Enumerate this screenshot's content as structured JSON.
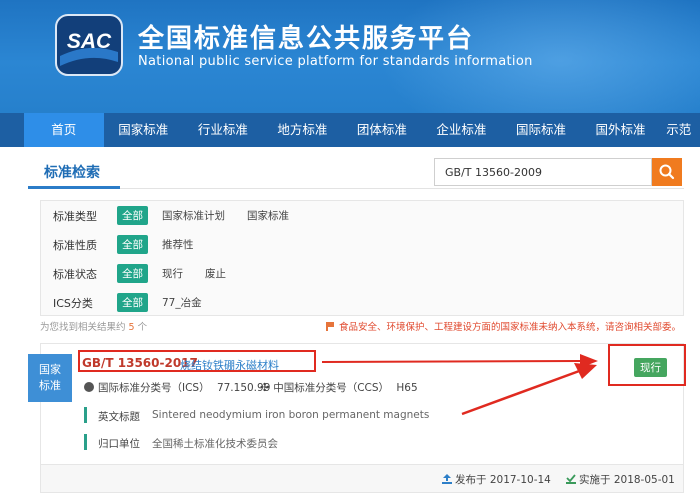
{
  "header": {
    "logo_text": "SAC",
    "title_cn": "全国标准信息公共服务平台",
    "title_en": "National public service platform  for standards information"
  },
  "nav": {
    "items": [
      {
        "label": "首页",
        "active": true
      },
      {
        "label": "国家标准"
      },
      {
        "label": "行业标准"
      },
      {
        "label": "地方标准"
      },
      {
        "label": "团体标准"
      },
      {
        "label": "企业标准"
      },
      {
        "label": "国际标准"
      },
      {
        "label": "国外标准"
      },
      {
        "label": "示范"
      }
    ]
  },
  "search": {
    "section_title": "标准检索",
    "value": "GB/T 13560-2009"
  },
  "filters": {
    "all_label": "全部",
    "rows": [
      {
        "label": "标准类型",
        "options": [
          "国家标准计划",
          "国家标准"
        ]
      },
      {
        "label": "标准性质",
        "options": [
          "推荐性"
        ]
      },
      {
        "label": "标准状态",
        "options": [
          "现行",
          "废止"
        ]
      },
      {
        "label": "ICS分类",
        "options": [
          "77_冶金"
        ]
      }
    ]
  },
  "results_summary": {
    "prefix": "为您找到相关结果约",
    "count": "5",
    "suffix": "个",
    "notice": "食品安全、环境保护、工程建设方面的国家标准未纳入本系统，请咨询相关部委。"
  },
  "result": {
    "badge_line1": "国家",
    "badge_line2": "标准",
    "code": "GB/T 13560-2017",
    "name": "烧结钕铁硼永磁材料",
    "status": "现行",
    "ics_label": "国际标准分类号（ICS）",
    "ics_value": "77.150.99",
    "ccs_label": "中国标准分类号（CCS）",
    "ccs_value": "H65",
    "en_title_label": "英文标题",
    "en_title_value": "Sintered neodymium iron boron permanent magnets",
    "owner_label": "归口单位",
    "owner_value": "全国稀土标准化技术委员会",
    "published": "发布于 2017-10-14",
    "effective": "实施于 2018-05-01"
  },
  "colors": {
    "header_blue": "#2680cc",
    "nav_blue": "#1d5fa3",
    "accent_orange": "#f07b1f",
    "tag_green": "#20a58a",
    "status_green": "#45a65f",
    "annotation_red": "#e02a20"
  }
}
